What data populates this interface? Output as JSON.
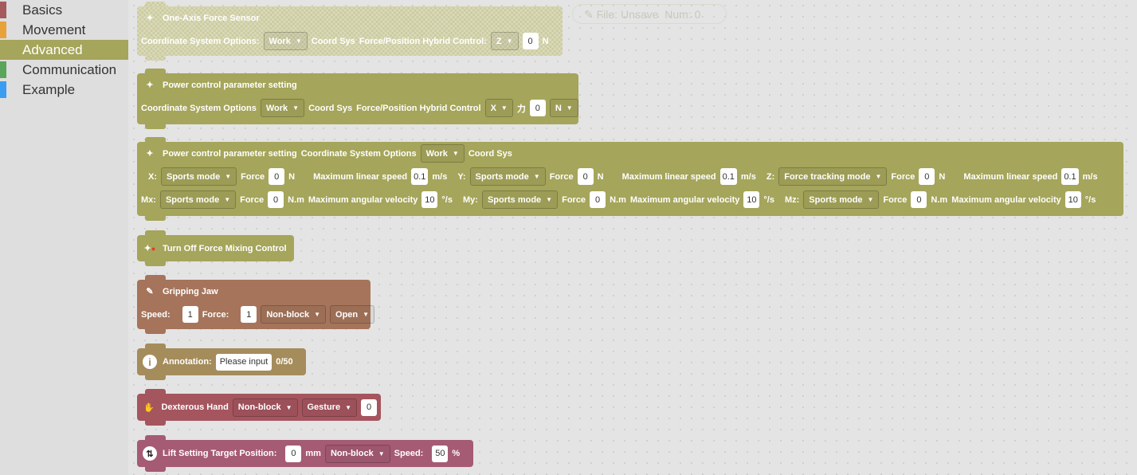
{
  "sidebar": {
    "categories": [
      {
        "label": "Basics",
        "color": "#a55b5b"
      },
      {
        "label": "Movement",
        "color": "#e8a23a"
      },
      {
        "label": "Advanced",
        "color": "#a5a55b",
        "selected": true
      },
      {
        "label": "Communication",
        "color": "#5ba55b"
      },
      {
        "label": "Example",
        "color": "#3b9df0"
      }
    ]
  },
  "file_status": {
    "file_label": "File:",
    "file_value": "Unsave",
    "num_label": "Num:",
    "num_value": "0"
  },
  "blocks": {
    "one_axis": {
      "title": "One-Axis Force Sensor",
      "coord_label": "Coordinate System Options:",
      "coord_value": "Work",
      "coord_sys": "Coord Sys",
      "hybrid_label": "Force/Position Hybrid Control:",
      "axis_value": "Z",
      "force_value": "0",
      "unit": "N"
    },
    "power1": {
      "title": "Power control parameter setting",
      "coord_label": "Coordinate System Options",
      "coord_value": "Work",
      "coord_sys": "Coord Sys",
      "hybrid_label": "Force/Position Hybrid Control",
      "axis_value": "X",
      "force_char": "力",
      "force_value": "0",
      "unit_value": "N"
    },
    "power2": {
      "title": "Power control parameter setting",
      "coord_label": "Coordinate System Options",
      "coord_value": "Work",
      "coord_sys": "Coord Sys",
      "linear": [
        {
          "axis": "X:",
          "mode": "Sports mode",
          "force_label": "Force",
          "force": "0",
          "force_unit": "N",
          "speed_label": "Maximum linear speed",
          "speed": "0.1",
          "speed_unit": "m/s"
        },
        {
          "axis": "Y:",
          "mode": "Sports mode",
          "force_label": "Force",
          "force": "0",
          "force_unit": "N",
          "speed_label": "Maximum linear speed",
          "speed": "0.1",
          "speed_unit": "m/s"
        },
        {
          "axis": "Z:",
          "mode": "Force tracking mode",
          "force_label": "Force",
          "force": "0",
          "force_unit": "N",
          "speed_label": "Maximum linear speed",
          "speed": "0.1",
          "speed_unit": "m/s"
        }
      ],
      "angular": [
        {
          "axis": "Mx:",
          "mode": "Sports mode",
          "force_label": "Force",
          "force": "0",
          "force_unit": "N.m",
          "speed_label": "Maximum angular velocity",
          "speed": "10",
          "speed_unit": "°/s"
        },
        {
          "axis": "My:",
          "mode": "Sports mode",
          "force_label": "Force",
          "force": "0",
          "force_unit": "N.m",
          "speed_label": "Maximum angular velocity",
          "speed": "10",
          "speed_unit": "°/s"
        },
        {
          "axis": "Mz:",
          "mode": "Sports mode",
          "force_label": "Force",
          "force": "0",
          "force_unit": "N.m",
          "speed_label": "Maximum angular velocity",
          "speed": "10",
          "speed_unit": "°/s"
        }
      ]
    },
    "turn_off": {
      "title": "Turn Off Force Mixing Control"
    },
    "gripper": {
      "title": "Gripping Jaw",
      "speed_label": "Speed:",
      "speed": "1",
      "force_label": "Force:",
      "force": "1",
      "block_mode": "Non-block",
      "action": "Open"
    },
    "annotation": {
      "label": "Annotation:",
      "placeholder": "Please input",
      "count": "0/50"
    },
    "hand": {
      "title": "Dexterous Hand",
      "block_mode": "Non-block",
      "mode": "Gesture",
      "value": "0"
    },
    "lift": {
      "title": "Lift Setting Target Position:",
      "position": "0",
      "unit": "mm",
      "block_mode": "Non-block",
      "speed_label": "Speed:",
      "speed": "50",
      "speed_unit": "%"
    }
  }
}
